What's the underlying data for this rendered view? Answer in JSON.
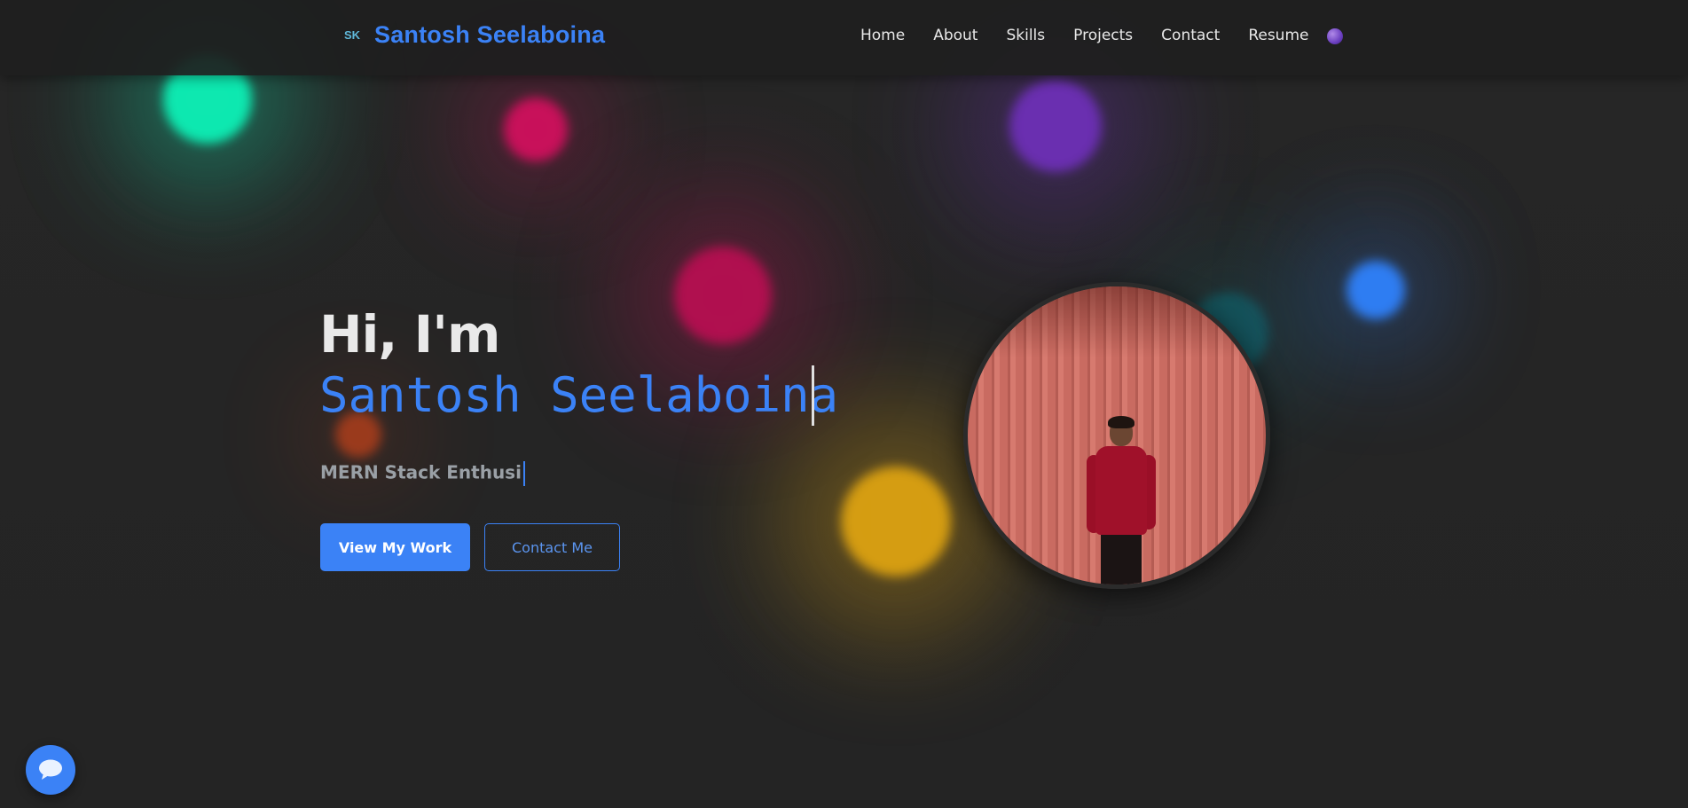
{
  "header": {
    "logo_text": "SK",
    "brand_name": "Santosh Seelaboina",
    "nav": [
      {
        "label": "Home"
      },
      {
        "label": "About"
      },
      {
        "label": "Skills"
      },
      {
        "label": "Projects"
      },
      {
        "label": "Contact"
      },
      {
        "label": "Resume"
      }
    ],
    "theme_toggle_icon": "moon-orb-icon"
  },
  "hero": {
    "greeting": "Hi, I'm",
    "name": "Santosh Seelaboina",
    "role_typed": "MERN Stack Enthusi",
    "primary_button": "View My Work",
    "secondary_button": "Contact Me",
    "photo_icon": "profile-photo"
  },
  "chat": {
    "icon": "chat-bubble-icon"
  },
  "colors": {
    "accent": "#3b82f6",
    "background": "#252525",
    "nav_background": "#1e1e1e",
    "text_primary": "#e9e9e9",
    "text_muted": "#9aa0a6"
  }
}
